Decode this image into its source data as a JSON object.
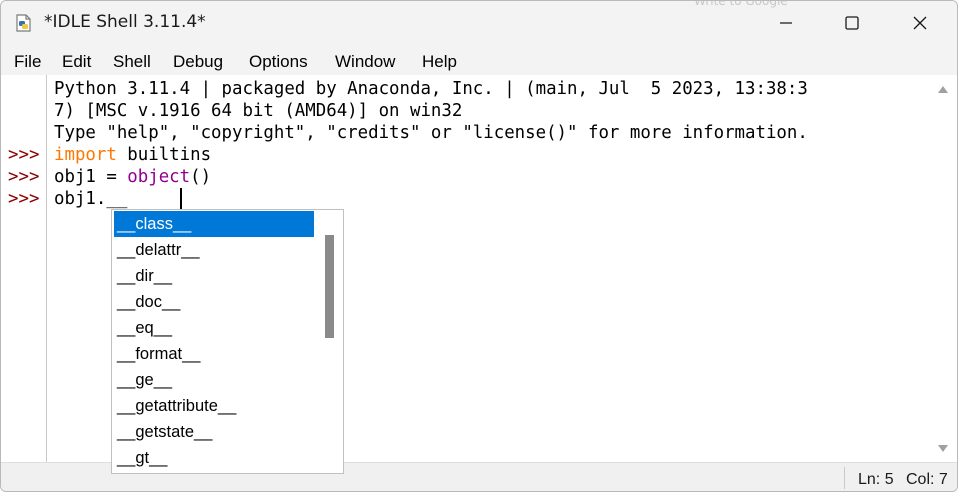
{
  "window": {
    "title": "*IDLE Shell 3.11.4*",
    "background_text": "Write to Google"
  },
  "menu": [
    "File",
    "Edit",
    "Shell",
    "Debug",
    "Options",
    "Window",
    "Help"
  ],
  "shell": {
    "prompt": ">>>",
    "banner": [
      "Python 3.11.4 | packaged by Anaconda, Inc. | (main, Jul  5 2023, 13:38:3",
      "7) [MSC v.1916 64 bit (AMD64)] on win32",
      "Type \"help\", \"copyright\", \"credits\" or \"license()\" for more information."
    ],
    "commands": [
      {
        "keyword": "import",
        "rest": " builtins"
      },
      {
        "prefix": "obj1 = ",
        "builtin": "object",
        "suffix": "()"
      },
      {
        "text": "obj1.__"
      }
    ]
  },
  "autocomplete": {
    "items": [
      "__class__",
      "__delattr__",
      "__dir__",
      "__doc__",
      "__eq__",
      "__format__",
      "__ge__",
      "__getattribute__",
      "__getstate__",
      "__gt__"
    ],
    "selected_index": 0
  },
  "status": {
    "line": "Ln: 5",
    "col": "Col: 7"
  },
  "colors": {
    "prompt": "#8b0000",
    "keyword": "#ff7700",
    "builtin": "#900090",
    "selection": "#0078d7"
  },
  "icons": [
    "python-idle-icon",
    "minimize-icon",
    "maximize-icon",
    "close-icon",
    "scroll-up-icon",
    "scroll-down-icon"
  ]
}
